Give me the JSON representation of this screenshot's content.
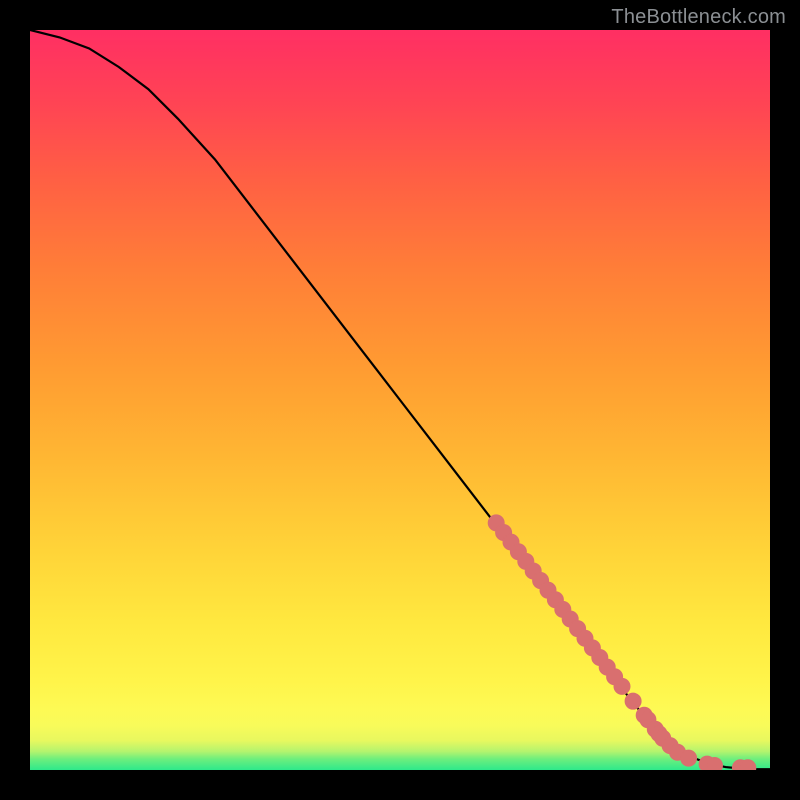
{
  "watermark": "TheBottleneck.com",
  "chart_data": {
    "type": "line",
    "title": "",
    "xlabel": "",
    "ylabel": "",
    "xlim": [
      0,
      100
    ],
    "ylim": [
      0,
      100
    ],
    "grid": false,
    "legend": false,
    "series": [
      {
        "name": "curve",
        "type": "line",
        "x": [
          0,
          4,
          8,
          12,
          16,
          20,
          25,
          30,
          35,
          40,
          45,
          50,
          55,
          60,
          65,
          70,
          75,
          80,
          82,
          84,
          86,
          88,
          90,
          92,
          94,
          96,
          98,
          100
        ],
        "y": [
          100,
          99,
          97.5,
          95,
          92,
          88,
          82.5,
          76,
          69.5,
          63,
          56.5,
          50,
          43.5,
          37,
          30.5,
          24,
          17.5,
          11,
          8.5,
          6,
          4,
          2.5,
          1.5,
          0.8,
          0.4,
          0.2,
          0.1,
          0.1
        ]
      },
      {
        "name": "dots",
        "type": "scatter",
        "x": [
          63,
          64,
          65,
          66,
          67,
          68,
          69,
          70,
          71,
          72,
          73,
          74,
          75,
          76,
          77,
          78,
          79,
          80,
          81.5,
          83,
          83.5,
          84.5,
          85,
          85.5,
          86.5,
          87.5,
          89,
          91.5,
          92.5,
          96,
          97
        ],
        "y": [
          33.4,
          32.1,
          30.8,
          29.5,
          28.2,
          26.9,
          25.6,
          24.3,
          23,
          21.7,
          20.4,
          19.1,
          17.8,
          16.5,
          15.2,
          13.9,
          12.6,
          11.3,
          9.3,
          7.4,
          6.8,
          5.5,
          4.9,
          4.3,
          3.3,
          2.4,
          1.6,
          0.8,
          0.6,
          0.3,
          0.3
        ]
      }
    ]
  }
}
